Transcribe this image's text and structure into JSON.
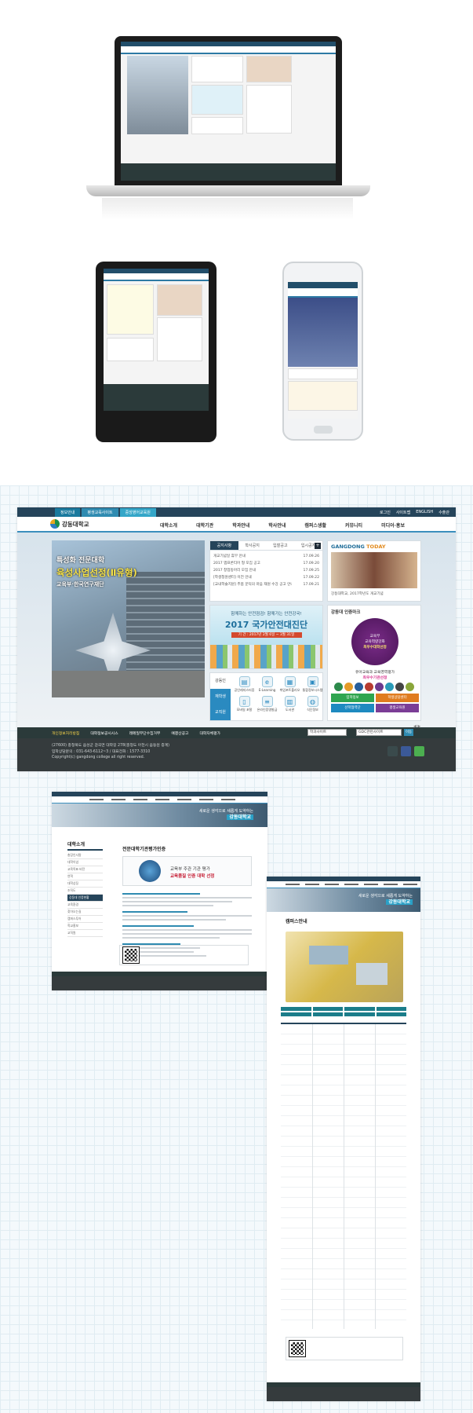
{
  "colors": {
    "navy": "#25445a",
    "accent": "#2f8bb1",
    "footer": "#353b3d",
    "footnav": "#2b3a3a",
    "highlight": "#f6e24a"
  },
  "util": {
    "tabs": [
      "정보안내",
      "평생교육사이트",
      "중앙영어교육원"
    ],
    "links": [
      "로그인",
      "사이트맵",
      "ENGLISH",
      "수출관"
    ]
  },
  "logo": {
    "name": "강동대학교"
  },
  "menu": [
    "대학소개",
    "대학기관",
    "학과안내",
    "학사안내",
    "캠퍼스생활",
    "커뮤니티",
    "미디어·홍보"
  ],
  "hero": {
    "line1": "특성화 전문대학",
    "line2": "육성사업선정(Ⅱ유형)",
    "line3": "교육부·한국연구재단"
  },
  "notice": {
    "tabs": [
      "공지사항",
      "학사공지",
      "입찰공고",
      "입시공지"
    ],
    "more": "+",
    "items": [
      {
        "title": "개교기념일 휴무 안내",
        "date": "17.09.26"
      },
      {
        "title": "2017 앱프론티어 형 모집 공고",
        "date": "17.09.20"
      },
      {
        "title": "2017 창업동아리 모집 안내",
        "date": "17.09.25"
      },
      {
        "title": "[학생청원센터] 이전 안내",
        "date": "17.09.22"
      },
      {
        "title": "[교내학술지원] 추봄 문턱의 마음 재원 수강 공고 안내",
        "date": "17.09.21"
      }
    ]
  },
  "safety": {
    "sub": "함께하는 안전점검! 함께가는 안전강국!",
    "title": "2017 국가안전대진단",
    "period": "기 간 : 2017년 2월 6일 ~ 3월 31일"
  },
  "quick": {
    "tabs": [
      "강동인",
      "재학생",
      "교직원"
    ],
    "items": [
      "공인레지스터증",
      "E-Learning",
      "취업포트폴리오",
      "통합정보시스템",
      "모바일 포탈",
      "온라인증명발급",
      "도서관",
      "식단정보"
    ]
  },
  "today": {
    "label": "GANGDONG",
    "label2": "TODAY",
    "caption": "강동대학교, 2017학년도 개교기념"
  },
  "accreditation": {
    "title": "강동대 인증마크",
    "badge_l1": "교육부",
    "badge_l2": "교육역량강화",
    "badge_l3": "최우수대학선정",
    "desc1": "유아교육과 교육영역평가",
    "desc2": "최우수기관선정",
    "buttons": [
      "입학정보",
      "학생상담센터",
      "산학협력단",
      "평생교육원"
    ]
  },
  "pager": "◀ ▶",
  "footnav": {
    "links": [
      "개인정보처리방침",
      "대학정보공시시스",
      "레메일무단수집거부",
      "예결산공고",
      "대학자체평가"
    ],
    "select1": "학과사이트",
    "select2": "GDC관련사이트",
    "go": "이동"
  },
  "footer": {
    "address": "(27600) 충청북도 음성군 감곡면 대학길 278(충청도 아천시 음동원 증계)",
    "tel": "입학상담문의 : 031-643-6112~3 / 대표전화 : 1577-3310",
    "copyright": "Copyright(c) gangdong college all right reserved."
  },
  "sub1": {
    "banner_l1": "새로운 생각으로 새롭게 도약하는",
    "banner_l2": "강동대학교",
    "side_title": "대학소개",
    "side_items": [
      "총장인사말",
      "대학이념",
      "교육목표·비전",
      "연혁",
      "대학상징",
      "조직도",
      "강동대 인증현황",
      "교육환경",
      "찾아오는길",
      "캠퍼스투어",
      "학교홍보",
      "교직원"
    ],
    "page_title": "전문대학기관평가인증",
    "box_l1": "교육부 주관 기관 평가",
    "box_l2": "교육품질 인증 대학 선정"
  },
  "sub2": {
    "page_title": "캠퍼스안내",
    "banner_l1": "새로운 생각으로 새롭게 도약하는",
    "banner_l2": "강동대학교"
  }
}
